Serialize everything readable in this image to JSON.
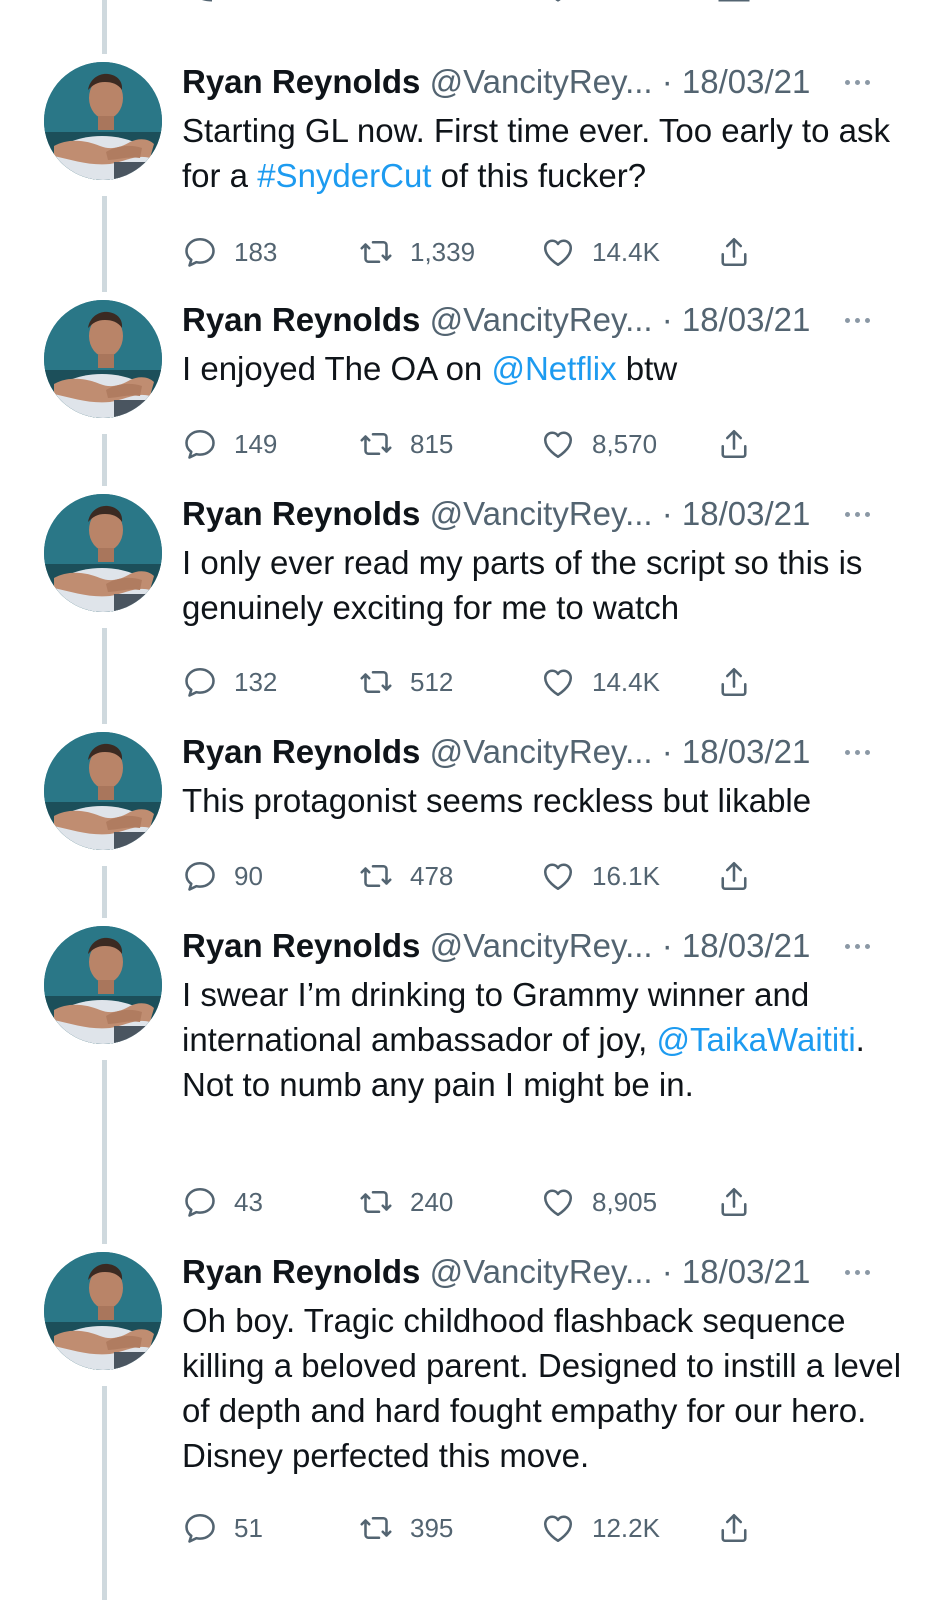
{
  "tweets": [
    {
      "name": "Ryan Reynolds",
      "handle": "@VancityRey... · 18/03/21",
      "text": [
        {
          "t": "Starting GL now. First time ever. Too early to ask for a "
        },
        {
          "t": "#SnyderCut",
          "link": true
        },
        {
          "t": " of this fucker?"
        }
      ],
      "replies": "183",
      "retweets": "1,339",
      "likes": "14.4K"
    },
    {
      "name": "Ryan Reynolds",
      "handle": "@VancityRey... · 18/03/21",
      "text": [
        {
          "t": "I enjoyed The OA on "
        },
        {
          "t": "@Netflix",
          "link": true
        },
        {
          "t": " btw"
        }
      ],
      "replies": "149",
      "retweets": "815",
      "likes": "8,570"
    },
    {
      "name": "Ryan Reynolds",
      "handle": "@VancityRey... · 18/03/21",
      "text": [
        {
          "t": "I only ever read my parts of the script so this is genuinely exciting for me to watch"
        }
      ],
      "replies": "132",
      "retweets": "512",
      "likes": "14.4K"
    },
    {
      "name": "Ryan Reynolds",
      "handle": "@VancityRey... · 18/03/21",
      "text": [
        {
          "t": "This protagonist seems reckless but likable"
        }
      ],
      "replies": "90",
      "retweets": "478",
      "likes": "16.1K"
    },
    {
      "name": "Ryan Reynolds",
      "handle": "@VancityRey... · 18/03/21",
      "text": [
        {
          "t": "I swear I’m drinking to Grammy winner and international ambassador of joy, "
        },
        {
          "t": "@TaikaWaititi",
          "link": true
        },
        {
          "t": ". Not to numb any pain I might be in."
        }
      ],
      "replies": "43",
      "retweets": "240",
      "likes": "8,905"
    },
    {
      "name": "Ryan Reynolds",
      "handle": "@VancityRey... · 18/03/21",
      "text": [
        {
          "t": "Oh boy. Tragic childhood flashback sequence killing a beloved parent. Designed to instill a level of depth and hard fought empathy for our hero. Disney perfected this move."
        }
      ],
      "replies": "51",
      "retweets": "395",
      "likes": "12.2K"
    }
  ],
  "colors": {
    "link": "#1d9bf0",
    "meta": "#536471",
    "thread": "#cfd9de"
  },
  "icons": [
    "reply-icon",
    "retweet-icon",
    "like-icon",
    "share-icon",
    "more-icon"
  ]
}
